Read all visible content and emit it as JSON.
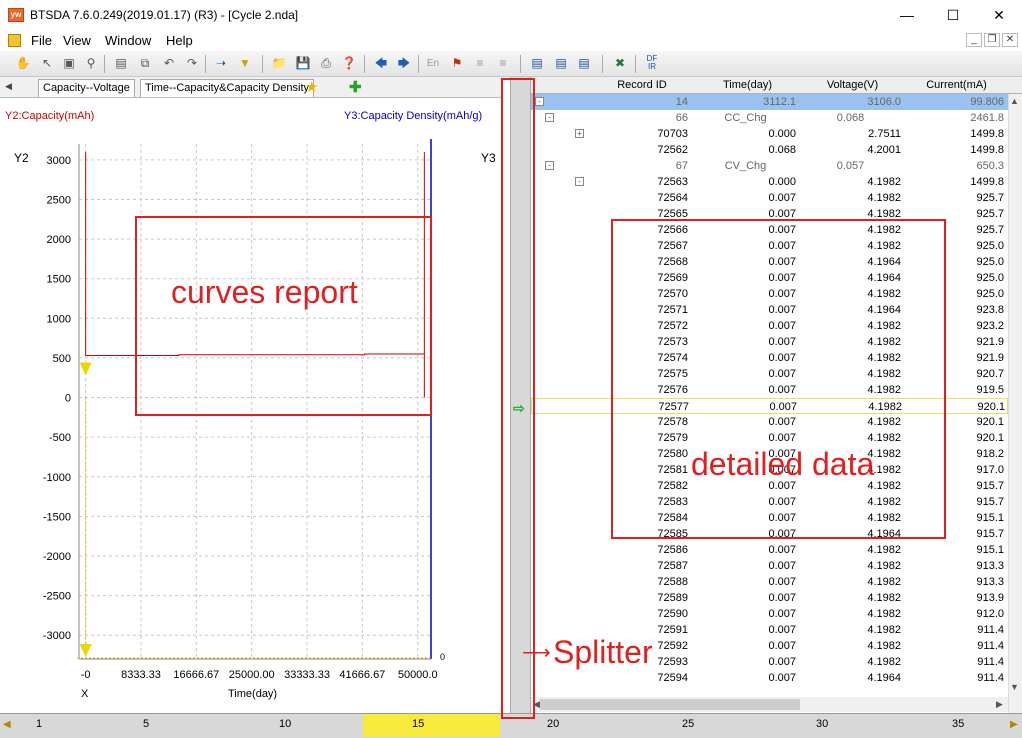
{
  "window": {
    "title": "BTSDA 7.6.0.249(2019.01.17) (R3) - [Cycle 2.nda]",
    "app_icon": "yw"
  },
  "menu": [
    "File",
    "View",
    "Window",
    "Help"
  ],
  "tabs": [
    "Capacity--Voltage",
    "Time--Capacity&Capacity Density"
  ],
  "chart": {
    "left_axis_label": "Y2:Capacity(mAh)",
    "right_axis_label": "Y3:Capacity Density(mAh/g)",
    "y2_tag": "Y2",
    "y3_tag": "Y3",
    "x_tag": "X",
    "x_title": "Time(day)",
    "y3_zero": "0",
    "y_ticks": [
      "3000",
      "2500",
      "2000",
      "1500",
      "1000",
      "500",
      "0",
      "-500",
      "-1000",
      "-1500",
      "-2000",
      "-2500",
      "-3000"
    ],
    "x_ticks": [
      "-0",
      "8333.33",
      "16666.67",
      "25000.00",
      "33333.33",
      "41666.67",
      "50000.0"
    ]
  },
  "chart_data": {
    "type": "line",
    "xlabel": "Time(day)",
    "ylabel": "Y2:Capacity(mAh)",
    "ylim": [
      -3300,
      3200
    ],
    "xlim": [
      -1000,
      52000
    ],
    "series": [
      {
        "x": [
          0,
          0,
          14000,
          14000,
          42000,
          42000,
          51000,
          51000,
          51000
        ],
        "y": [
          3100,
          530,
          530,
          540,
          540,
          550,
          550,
          3100,
          0
        ]
      }
    ]
  },
  "grid": {
    "headers": [
      "Record ID",
      "Time(day)",
      "Voltage(V)",
      "Current(mA)"
    ],
    "selected": {
      "id": "14",
      "time": "3112.1",
      "volt": "3106.0",
      "cur": "99.806"
    },
    "group1": {
      "id": "66",
      "time": "CC_Chg",
      "volt": "0.068",
      "cur": "2461.8"
    },
    "group1_rows": [
      [
        "70703",
        "0.000",
        "2.7511",
        "1499.8"
      ],
      [
        "72562",
        "0.068",
        "4.2001",
        "1499.8"
      ]
    ],
    "group2": {
      "id": "67",
      "time": "CV_Chg",
      "volt": "0.057",
      "cur": "650.3"
    },
    "group2_rows": [
      [
        "72563",
        "0.000",
        "4.1982",
        "1499.8"
      ],
      [
        "72564",
        "0.007",
        "4.1982",
        "925.7"
      ],
      [
        "72565",
        "0.007",
        "4.1982",
        "925.7"
      ],
      [
        "72566",
        "0.007",
        "4.1982",
        "925.7"
      ],
      [
        "72567",
        "0.007",
        "4.1982",
        "925.0"
      ],
      [
        "72568",
        "0.007",
        "4.1964",
        "925.0"
      ],
      [
        "72569",
        "0.007",
        "4.1964",
        "925.0"
      ],
      [
        "72570",
        "0.007",
        "4.1982",
        "925.0"
      ],
      [
        "72571",
        "0.007",
        "4.1964",
        "923.8"
      ],
      [
        "72572",
        "0.007",
        "4.1982",
        "923.2"
      ],
      [
        "72573",
        "0.007",
        "4.1982",
        "921.9"
      ],
      [
        "72574",
        "0.007",
        "4.1982",
        "921.9"
      ],
      [
        "72575",
        "0.007",
        "4.1982",
        "920.7"
      ],
      [
        "72576",
        "0.007",
        "4.1982",
        "919.5"
      ],
      [
        "72577",
        "0.007",
        "4.1982",
        "920.1"
      ],
      [
        "72578",
        "0.007",
        "4.1982",
        "920.1"
      ],
      [
        "72579",
        "0.007",
        "4.1982",
        "920.1"
      ],
      [
        "72580",
        "0.007",
        "4.1982",
        "918.2"
      ],
      [
        "72581",
        "0.007",
        "4.1982",
        "917.0"
      ],
      [
        "72582",
        "0.007",
        "4.1982",
        "915.7"
      ],
      [
        "72583",
        "0.007",
        "4.1982",
        "915.7"
      ],
      [
        "72584",
        "0.007",
        "4.1982",
        "915.1"
      ],
      [
        "72585",
        "0.007",
        "4.1964",
        "915.7"
      ],
      [
        "72586",
        "0.007",
        "4.1982",
        "915.1"
      ],
      [
        "72587",
        "0.007",
        "4.1982",
        "913.3"
      ],
      [
        "72588",
        "0.007",
        "4.1982",
        "913.3"
      ],
      [
        "72589",
        "0.007",
        "4.1982",
        "913.9"
      ],
      [
        "72590",
        "0.007",
        "4.1982",
        "912.0"
      ],
      [
        "72591",
        "0.007",
        "4.1982",
        "911.4"
      ],
      [
        "72592",
        "0.007",
        "4.1982",
        "911.4"
      ],
      [
        "72593",
        "0.007",
        "4.1982",
        "911.4"
      ],
      [
        "72594",
        "0.007",
        "4.1964",
        "911.4"
      ]
    ]
  },
  "cycle_bar": [
    "1",
    "5",
    "10",
    "15",
    "20",
    "25",
    "30",
    "35"
  ],
  "annotations": {
    "curves": "curves report",
    "detailed": "detailed data",
    "splitter": "Splitter"
  },
  "colors": {
    "capacity": "#cc0000",
    "density": "#0000cc",
    "selected_row": "#99c2f0",
    "cursor": "#e8d800",
    "annotation": "#e02020"
  }
}
